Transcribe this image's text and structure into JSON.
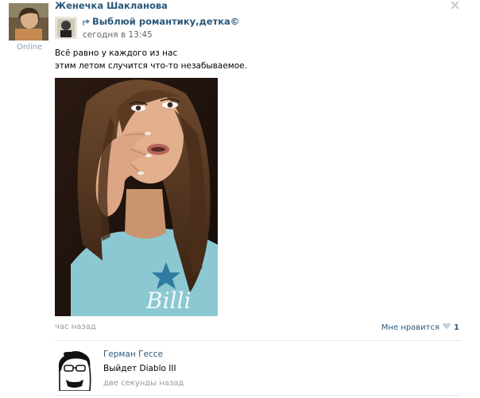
{
  "post": {
    "author": "Женечка Шакланова",
    "status": "Online",
    "repost": {
      "source_name": "Выблюй романтику,детка©",
      "time": "сегодня в 13:45"
    },
    "text_line1": "Всё равно у каждого из нас",
    "text_line2": "этим летом случится что-то незабываемое.",
    "time_ago": "час назад",
    "like_label": "Мне нравится",
    "like_count": "1"
  },
  "comment": {
    "author": "Герман Гессе",
    "text": "Выйдет Diablo III",
    "time": "две секунды назад"
  },
  "colors": {
    "link": "#2b587a",
    "muted": "#999999",
    "divider": "#e5e9ee"
  }
}
